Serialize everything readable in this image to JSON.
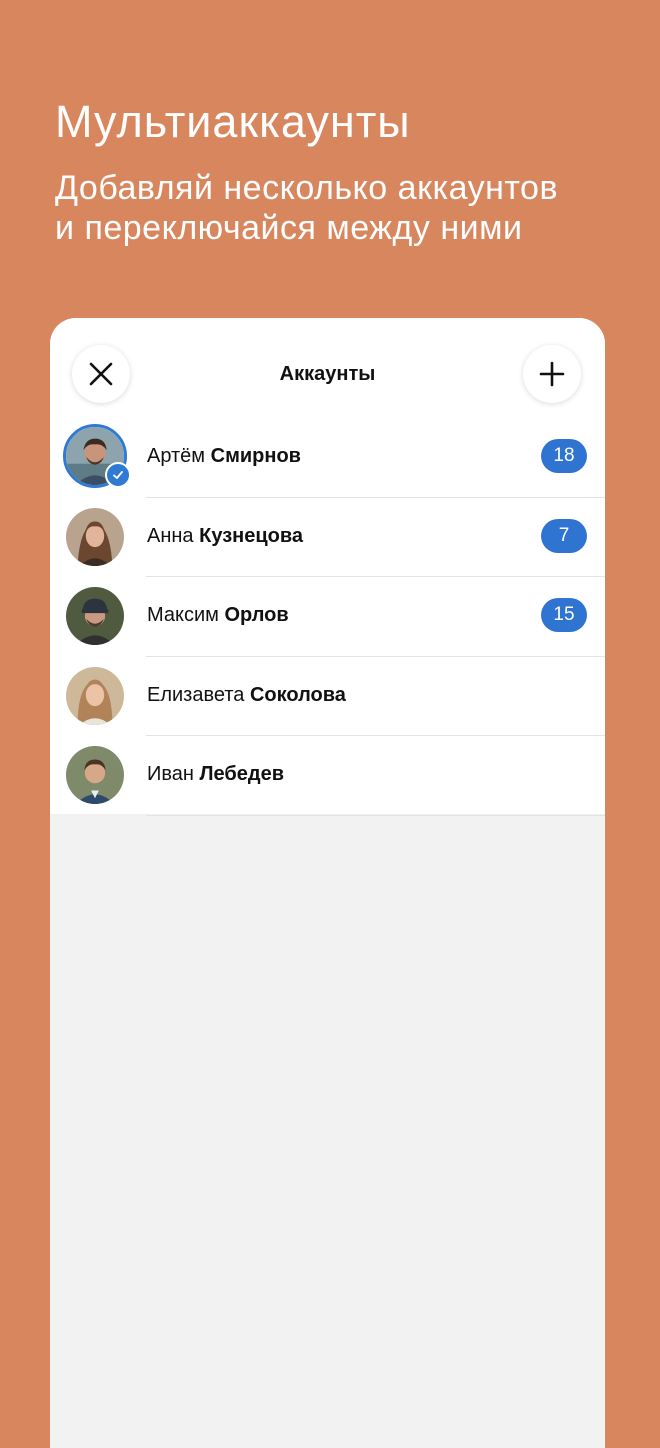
{
  "hero": {
    "title": "Мультиаккаунты",
    "subtitle_line1": "Добавляй несколько аккаунтов",
    "subtitle_line2": "и переключайся между ними"
  },
  "sheet": {
    "title": "Аккаунты",
    "close_icon": "close-icon",
    "add_icon": "plus-icon"
  },
  "accounts": [
    {
      "first": "Артём",
      "last": "Смирнов",
      "badge": "18",
      "active": true
    },
    {
      "first": "Анна",
      "last": "Кузнецова",
      "badge": "7",
      "active": false
    },
    {
      "first": "Максим",
      "last": "Орлов",
      "badge": "15",
      "active": false
    },
    {
      "first": "Елизавета",
      "last": "Соколова",
      "badge": "",
      "active": false
    },
    {
      "first": "Иван",
      "last": "Лебедев",
      "badge": "",
      "active": false
    }
  ],
  "colors": {
    "background": "#D8865E",
    "accent": "#2F74D0",
    "card": "#FFFFFF",
    "sheet_bottom": "#F2F2F3"
  }
}
